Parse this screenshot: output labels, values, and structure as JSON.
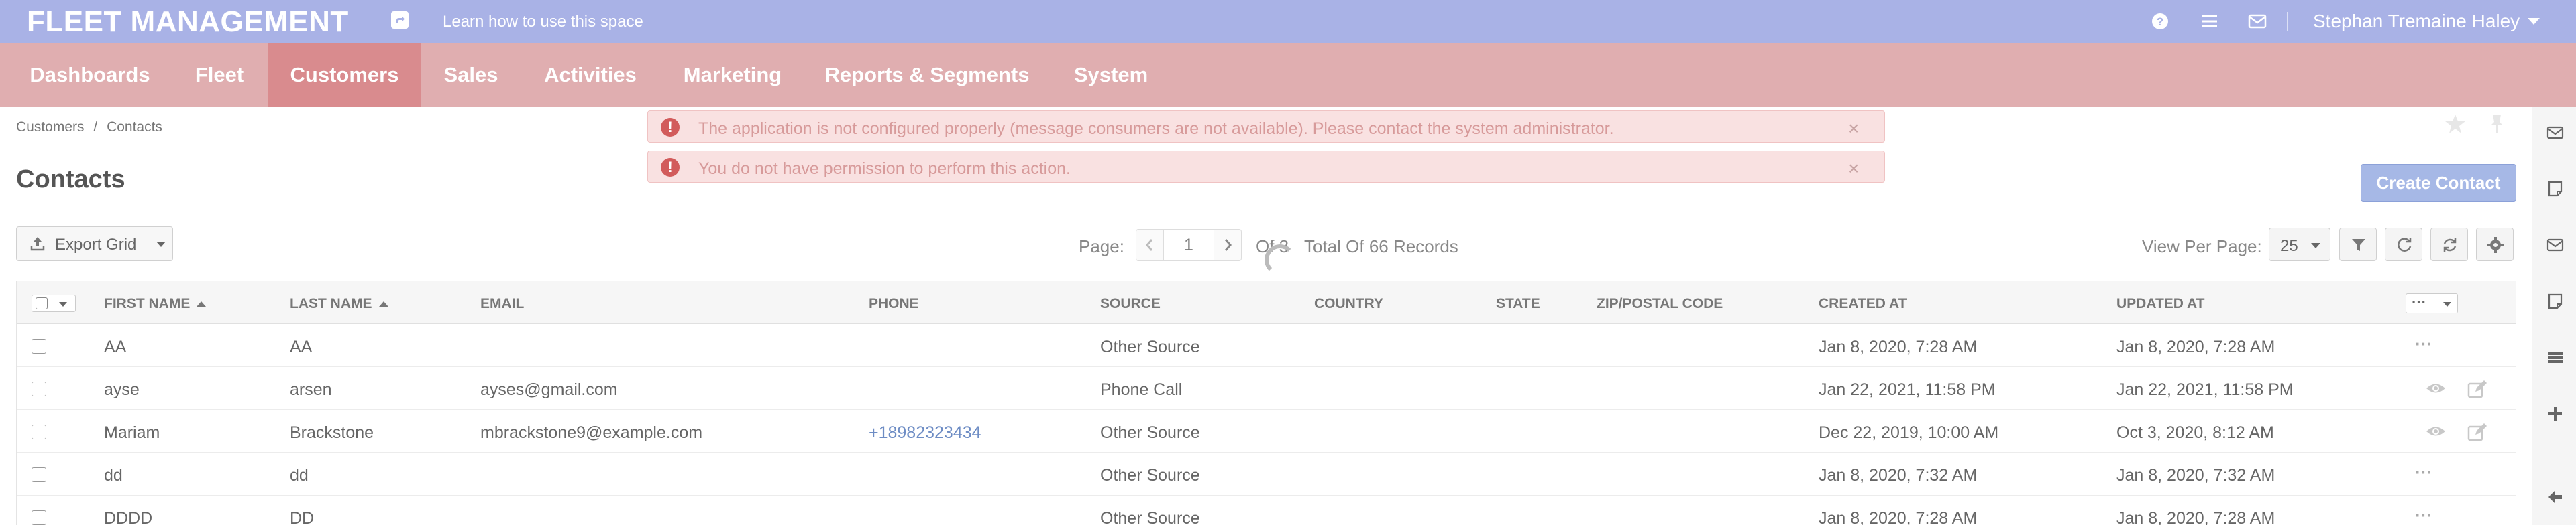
{
  "header": {
    "app_title": "FLEET MANAGEMENT",
    "learn_link": "Learn how to use this space",
    "user_name": "Stephan Tremaine Haley",
    "icons": [
      "share-icon",
      "help-icon",
      "list-icon",
      "mail-icon"
    ],
    "bg_color": "#a9b2e6"
  },
  "nav": {
    "items": [
      "Dashboards",
      "Fleet",
      "Customers",
      "Sales",
      "Activities",
      "Marketing",
      "Reports & Segments",
      "System"
    ],
    "active": "Customers",
    "bg_color": "#e0aeb0",
    "active_color": "#d98b8e"
  },
  "breadcrumb": {
    "parent": "Customers",
    "separator": "/",
    "current": "Contacts"
  },
  "alerts": [
    "The application is not configured properly (message consumers are not available). Please contact the system administrator.",
    "You do not have permission to perform this action."
  ],
  "alert_close": "×",
  "page": {
    "title": "Contacts",
    "create_button": "Create Contact"
  },
  "toolbar": {
    "export_label": "Export Grid",
    "page_label": "Page:",
    "page_value": "1",
    "of_label": "Of 3",
    "total_label": "Total Of 66 Records",
    "view_per_page_label": "View Per Page:",
    "view_per_page_value": "25"
  },
  "grid": {
    "columns": [
      "FIRST NAME",
      "LAST NAME",
      "EMAIL",
      "PHONE",
      "SOURCE",
      "COUNTRY",
      "STATE",
      "ZIP/POSTAL CODE",
      "CREATED AT",
      "UPDATED AT"
    ],
    "actions_label": "···",
    "rows": [
      {
        "first": "AA",
        "last": "AA",
        "email": "",
        "phone": "",
        "source": "Other Source",
        "created": "Jan 8, 2020, 7:28 AM",
        "updated": "Jan 8, 2020, 7:28 AM"
      },
      {
        "first": "ayse",
        "last": "arsen",
        "email": "ayses@gmail.com",
        "phone": "",
        "source": "Phone Call",
        "created": "Jan 22, 2021, 11:58 PM",
        "updated": "Jan 22, 2021, 11:58 PM"
      },
      {
        "first": "Mariam",
        "last": "Brackstone",
        "email": "mbrackstone9@example.com",
        "phone": "+18982323434",
        "source": "Other Source",
        "created": "Dec 22, 2019, 10:00 AM",
        "updated": "Oct 3, 2020, 8:12 AM"
      },
      {
        "first": "dd",
        "last": "dd",
        "email": "",
        "phone": "",
        "source": "Other Source",
        "created": "Jan 8, 2020, 7:32 AM",
        "updated": "Jan 8, 2020, 7:32 AM"
      },
      {
        "first": "DDDD",
        "last": "DD",
        "email": "",
        "phone": "",
        "source": "Other Source",
        "created": "Jan 8, 2020, 7:28 AM",
        "updated": "Jan 8, 2020, 7:28 AM"
      }
    ]
  }
}
